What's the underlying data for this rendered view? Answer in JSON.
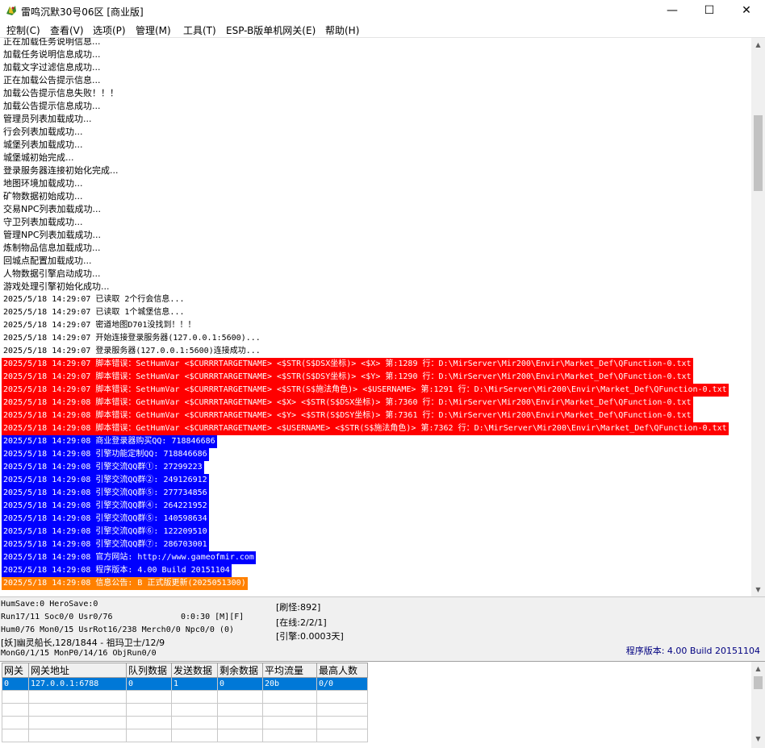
{
  "window": {
    "title": "雷鸣沉默30号06区 [商业版]",
    "minimize": "—",
    "maximize": "☐",
    "close": "✕"
  },
  "menu": [
    {
      "label": "控制(C)"
    },
    {
      "label": "查看(V)"
    },
    {
      "label": "选项(P)"
    },
    {
      "label": "管理(M)"
    },
    {
      "label": "工具(T)"
    },
    {
      "label": "ESP-B版单机网关(E)"
    },
    {
      "label": "帮助(H)"
    }
  ],
  "log": [
    {
      "text": "正在加载任务说明信息...",
      "style": "plain"
    },
    {
      "text": "加载任务说明信息成功...",
      "style": "plain"
    },
    {
      "text": "加载文字过滤信息成功...",
      "style": "plain"
    },
    {
      "text": "正在加载公告提示信息...",
      "style": "plain"
    },
    {
      "text": "加载公告提示信息失败！！！",
      "style": "plain"
    },
    {
      "text": "加载公告提示信息成功...",
      "style": "plain"
    },
    {
      "text": "管理员列表加载成功...",
      "style": "plain"
    },
    {
      "text": "行会列表加载成功...",
      "style": "plain"
    },
    {
      "text": "城堡列表加载成功...",
      "style": "plain"
    },
    {
      "text": "城堡城初始完成...",
      "style": "plain"
    },
    {
      "text": "登录服务器连接初始化完成...",
      "style": "plain"
    },
    {
      "text": "地图环境加载成功...",
      "style": "plain"
    },
    {
      "text": "矿物数据初始成功...",
      "style": "plain"
    },
    {
      "text": "交易NPC列表加载成功...",
      "style": "plain"
    },
    {
      "text": "守卫列表加载成功...",
      "style": "plain"
    },
    {
      "text": "管理NPC列表加载成功...",
      "style": "plain"
    },
    {
      "text": "炼制物品信息加载成功...",
      "style": "plain"
    },
    {
      "text": "回城点配置加载成功...",
      "style": "plain"
    },
    {
      "text": "人物数据引擎启动成功...",
      "style": "plain"
    },
    {
      "text": "游戏处理引擎初始化成功...",
      "style": "plain"
    },
    {
      "text": "2025/5/18 14:29:07 已读取 2个行会信息...",
      "style": "plain"
    },
    {
      "text": "2025/5/18 14:29:07 已读取 1个城堡信息...",
      "style": "plain"
    },
    {
      "text": "2025/5/18 14:29:07 密道地图D701没找到！！！",
      "style": "plain"
    },
    {
      "text": "2025/5/18 14:29:07 开始连接登录服务器(127.0.0.1:5600)...",
      "style": "plain"
    },
    {
      "text": "2025/5/18 14:29:07 登录服务器(127.0.0.1:5600)连接成功...",
      "style": "plain"
    },
    {
      "text": "2025/5/18 14:29:07 脚本错误：SetHumVar <$CURRRTARGETNAME> <$STR(S$DSX坐标)> <$X> 第:1289 行：D:\\MirServer\\Mir200\\Envir\\Market_Def\\QFunction-0.txt",
      "style": "red"
    },
    {
      "text": "2025/5/18 14:29:07 脚本错误：SetHumVar <$CURRRTARGETNAME> <$STR(S$DSY坐标)> <$Y> 第:1290 行：D:\\MirServer\\Mir200\\Envir\\Market_Def\\QFunction-0.txt",
      "style": "red"
    },
    {
      "text": "2025/5/18 14:29:07 脚本错误：SetHumVar <$CURRRTARGETNAME> <$STR(S$施法角色)> <$USERNAME> 第:1291 行：D:\\MirServer\\Mir200\\Envir\\Market_Def\\QFunction-0.txt",
      "style": "red"
    },
    {
      "text": "2025/5/18 14:29:08 脚本错误：GetHumVar <$CURRRTARGETNAME> <$X> <$STR(S$DSX坐标)> 第:7360 行：D:\\MirServer\\Mir200\\Envir\\Market_Def\\QFunction-0.txt",
      "style": "red"
    },
    {
      "text": "2025/5/18 14:29:08 脚本错误：GetHumVar <$CURRRTARGETNAME> <$Y> <$STR(S$DSY坐标)> 第:7361 行：D:\\MirServer\\Mir200\\Envir\\Market_Def\\QFunction-0.txt",
      "style": "red"
    },
    {
      "text": "2025/5/18 14:29:08 脚本错误：GetHumVar <$CURRRTARGETNAME> <$USERNAME> <$STR(S$施法角色)> 第:7362 行：D:\\MirServer\\Mir200\\Envir\\Market_Def\\QFunction-0.txt",
      "style": "red"
    },
    {
      "text": "2025/5/18 14:29:08 商业登录器购买QQ: 718846686",
      "style": "blue"
    },
    {
      "text": "2025/5/18 14:29:08 引擎功能定制QQ: 718846686",
      "style": "blue"
    },
    {
      "text": "2025/5/18 14:29:08 引擎交流QQ群①: 27299223",
      "style": "blue"
    },
    {
      "text": "2025/5/18 14:29:08 引擎交流QQ群②: 249126912",
      "style": "blue"
    },
    {
      "text": "2025/5/18 14:29:08 引擎交流QQ群⑤: 277734856",
      "style": "blue"
    },
    {
      "text": "2025/5/18 14:29:08 引擎交流QQ群④: 264221952",
      "style": "blue"
    },
    {
      "text": "2025/5/18 14:29:08 引擎交流QQ群⑤: 140598634",
      "style": "blue"
    },
    {
      "text": "2025/5/18 14:29:08 引擎交流QQ群⑥: 122209510",
      "style": "blue"
    },
    {
      "text": "2025/5/18 14:29:08 引擎交流QQ群⑦: 286703001",
      "style": "blue"
    },
    {
      "text": "2025/5/18 14:29:08 官方网站: http://www.gameofmir.com",
      "style": "blue"
    },
    {
      "text": "2025/5/18 14:29:08 程序版本: 4.00 Build 20151104",
      "style": "blue"
    },
    {
      "text": "2025/5/18 14:29:08 信息公告: B 正式版更新(2025051300)",
      "style": "orange"
    }
  ],
  "status": {
    "line1": "HumSave:0 HeroSave:0",
    "line2a": "Run17/11 Soc0/0 Usr0/76",
    "line2b": "0:0:30 [M][F]",
    "line3": "Hum0/76 Mon0/15 UsrRot16/238 Merch0/0 Npc0/0 (0)",
    "line4": "[妖]幽灵船长,128/1844 - 祖玛卫士/12/9",
    "line5": "MonG0/1/15 MonP0/14/16 ObjRun0/0",
    "refresh": "[刷怪:892]",
    "online": "[在线:2/2/1]",
    "engine": "[引擎:0.0003天]",
    "version": "程序版本: 4.00 Build 20151104"
  },
  "gateway_table": {
    "headers": [
      "网关",
      "网关地址",
      "队列数据",
      "发送数据",
      "剩余数据",
      "平均流量",
      "最高人数"
    ],
    "rows": [
      [
        "0",
        "127.0.0.1:6788",
        "0",
        "1",
        "0",
        "20b",
        "0/0"
      ]
    ]
  }
}
